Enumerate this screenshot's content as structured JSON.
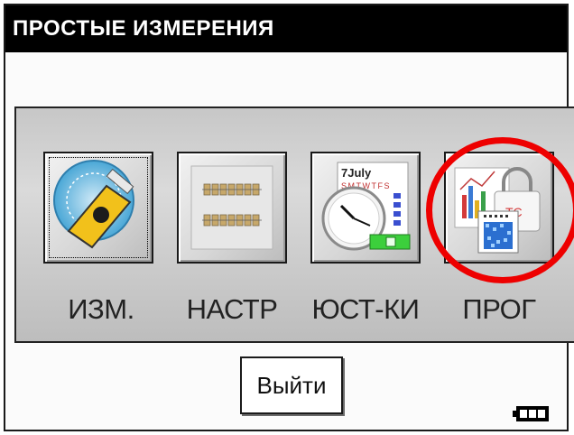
{
  "window": {
    "title": "ПРОСТЫЕ ИЗМЕРЕНИЯ"
  },
  "menu": {
    "items": [
      {
        "label": "ИЗМ.",
        "icon": "measuring-tape-icon"
      },
      {
        "label": "НАСТР",
        "icon": "settings-panel-icon"
      },
      {
        "label": "ЮСТ-КИ",
        "icon": "calendar-clock-icon"
      },
      {
        "label": "ПРОГ",
        "icon": "programs-icon"
      }
    ]
  },
  "calendar_icon_text": {
    "month": "7July",
    "days": "SMTWTFS"
  },
  "footer": {
    "exit_label": "Выйти",
    "battery": "battery-full-icon"
  },
  "colors": {
    "highlight": "#ee0000",
    "titlebar": "#000000"
  }
}
